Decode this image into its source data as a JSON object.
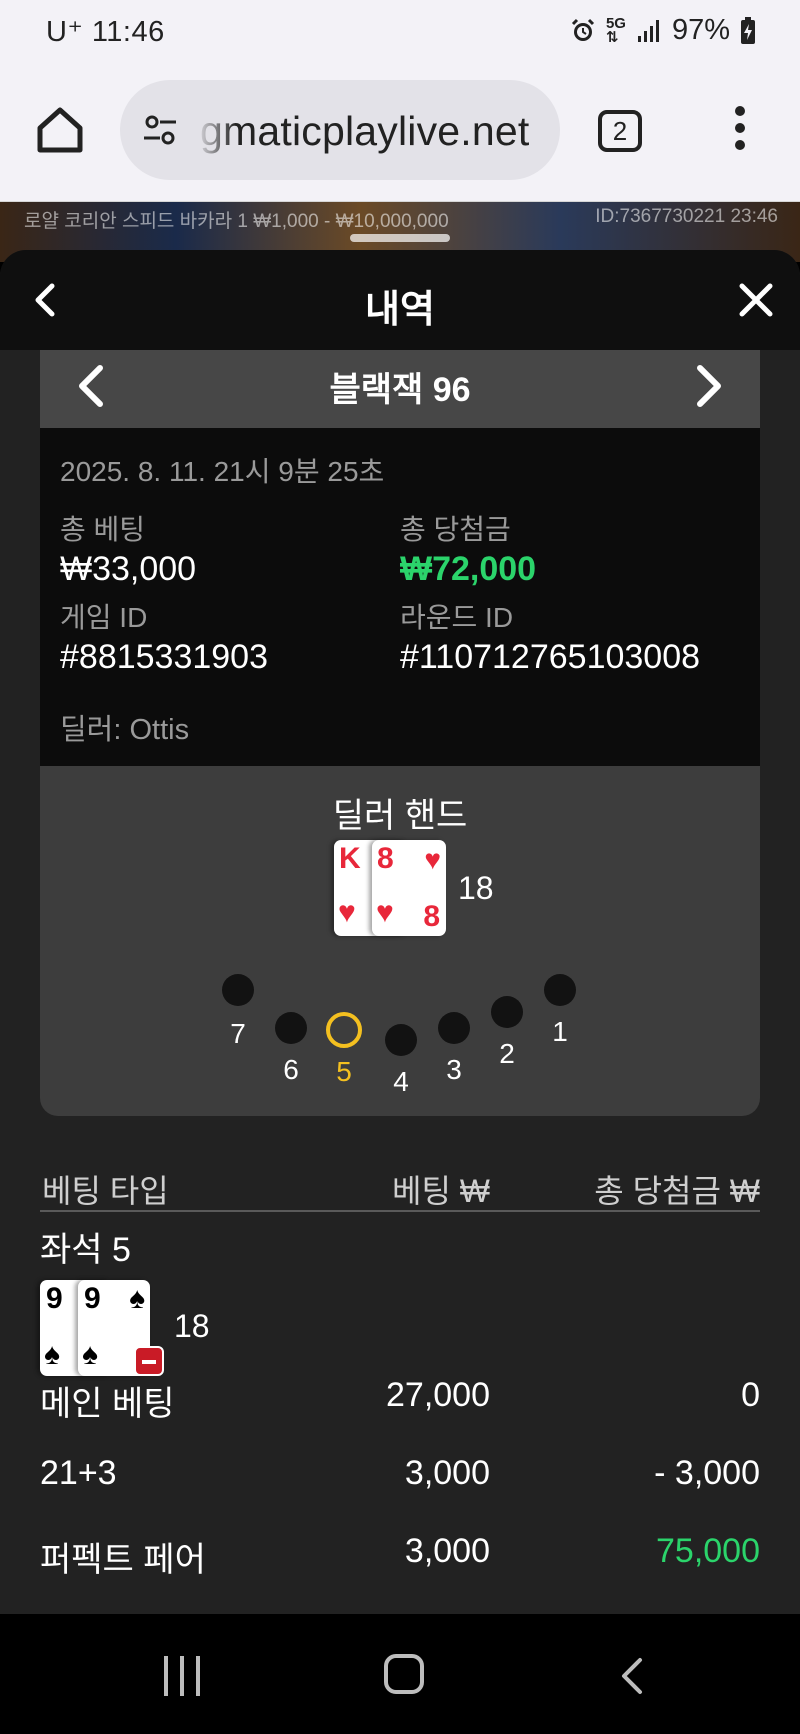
{
  "status_bar": {
    "carrier": "U⁺",
    "time": "11:46",
    "network": "5G",
    "battery": "97%",
    "icons": [
      "alarm-icon",
      "network-5g-icon",
      "signal-icon",
      "battery-charging-icon"
    ]
  },
  "browser": {
    "url": "gmaticplaylive.net",
    "tab_count": "2",
    "icons": [
      "home-icon",
      "tune-icon",
      "tabs-icon",
      "more-vert-icon"
    ]
  },
  "video_strip": {
    "table_info": "로얄 코리안 스피드 바카라 1 ₩1,000 - ₩10,000,000",
    "round_info": "ID:7367730221 23:46"
  },
  "panel": {
    "title": "내역",
    "game_title": "블랙잭 96",
    "datetime": "2025. 8. 11. 21시 9분 25초",
    "total_bet_label": "총 베팅",
    "total_bet_value": "₩33,000",
    "total_win_label": "총 당첨금",
    "total_win_value": "₩72,000",
    "game_id_label": "게임 ID",
    "game_id_value": "#8815331903",
    "round_id_label": "라운드 ID",
    "round_id_value": "#110712765103008",
    "dealer": "딜러: Ottis"
  },
  "dealer_hand": {
    "title": "딜러 핸드",
    "cards": [
      {
        "rank": "K",
        "suit": "♥",
        "color": "#e8273a"
      },
      {
        "rank": "8",
        "suit": "♥",
        "color": "#e8273a"
      }
    ],
    "total": "18"
  },
  "seats": [
    {
      "number": "7",
      "active": false
    },
    {
      "number": "6",
      "active": false
    },
    {
      "number": "5",
      "active": true
    },
    {
      "number": "4",
      "active": false
    },
    {
      "number": "3",
      "active": false
    },
    {
      "number": "2",
      "active": false
    },
    {
      "number": "1",
      "active": false
    }
  ],
  "bets_table": {
    "headers": [
      "베팅 타입",
      "베팅 ₩",
      "총 당첨금 ₩"
    ],
    "seat_label": "좌석 5",
    "player_cards": [
      {
        "rank": "9",
        "suit": "♠"
      },
      {
        "rank": "9",
        "suit": "♠"
      }
    ],
    "player_total": "18",
    "rows": [
      {
        "type": "메인 베팅",
        "bet": "27,000",
        "win": "0",
        "win_color": "#ffffff"
      },
      {
        "type": "21+3",
        "bet": "3,000",
        "win": "- 3,000",
        "win_color": "#ffffff"
      },
      {
        "type": "퍼펙트 페어",
        "bet": "3,000",
        "win": "75,000",
        "win_color": "#2bd46b"
      }
    ]
  },
  "colors": {
    "win_green": "#2bd46b",
    "active_seat": "#f4c020",
    "card_red": "#e8273a"
  }
}
